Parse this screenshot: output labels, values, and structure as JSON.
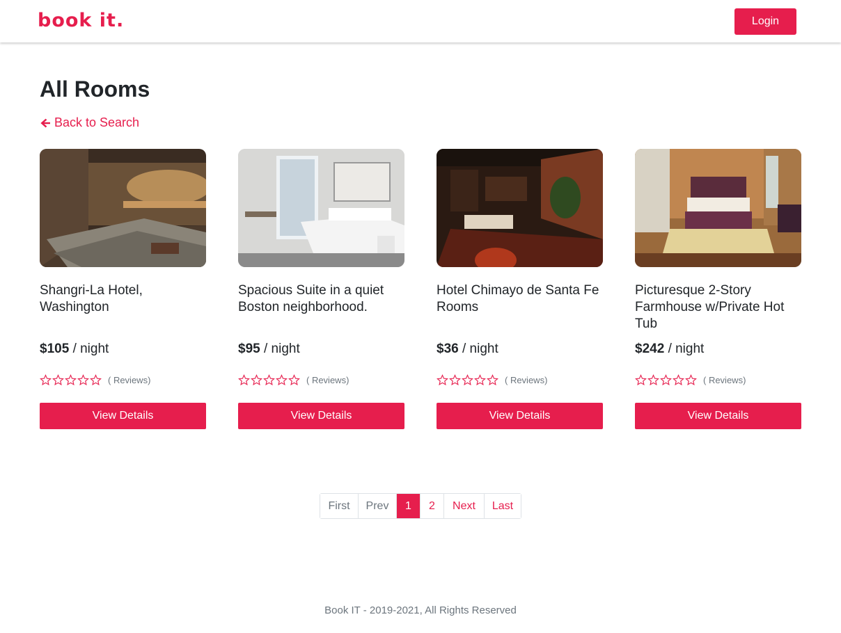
{
  "brand": {
    "logo": "book it.",
    "accent_color": "#e61e4d"
  },
  "nav": {
    "login_label": "Login"
  },
  "page": {
    "title": "All Rooms",
    "back_link": "Back to Search"
  },
  "rooms": [
    {
      "name": "Shangri-La Hotel, Washington",
      "price": "$105",
      "per": "/ night",
      "reviews": "( Reviews)",
      "button": "View Details",
      "rating": 0,
      "image": "spa-room-photo"
    },
    {
      "name": "Spacious Suite in a quiet Boston neighborhood.",
      "price": "$95",
      "per": "/ night",
      "reviews": "( Reviews)",
      "button": "View Details",
      "rating": 0,
      "image": "white-suite-photo"
    },
    {
      "name": "Hotel Chimayo de Santa Fe Rooms",
      "price": "$36",
      "per": "/ night",
      "reviews": "( Reviews)",
      "button": "View Details",
      "rating": 0,
      "image": "brick-room-photo"
    },
    {
      "name": "Picturesque 2-Story Farmhouse w/Private Hot Tub",
      "price": "$242",
      "per": "/ night",
      "reviews": "( Reviews)",
      "button": "View Details",
      "rating": 0,
      "image": "purple-bed-photo"
    }
  ],
  "pagination": {
    "first": "First",
    "prev": "Prev",
    "pages": [
      "1",
      "2"
    ],
    "current": "1",
    "next": "Next",
    "last": "Last"
  },
  "footer": {
    "text": "Book IT - 2019-2021, All Rights Reserved"
  }
}
